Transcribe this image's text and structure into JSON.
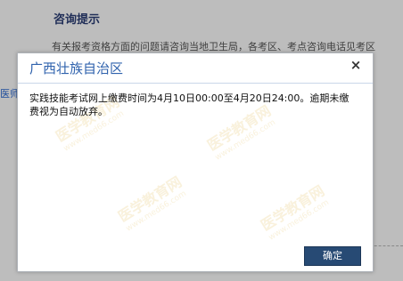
{
  "background": {
    "section_title": "咨询提示",
    "notice_text": "有关报考资格方面的问题请咨询当地卫生局，各考区、考点咨询电话见考区",
    "edge_link": "医师"
  },
  "dialog": {
    "title": "广西壮族自治区",
    "close_symbol": "×",
    "message": "实践技能考试网上缴费时间为4月10日00:00至4月20日24:00。逾期未缴费视为自动放弃。",
    "confirm_label": "确定",
    "watermark_text": "医学教育网",
    "watermark_url": "www.med66.com"
  },
  "colors": {
    "dialog_title": "#2f62ad",
    "confirm_button": "#274a74",
    "overlay": "#bdbdbd"
  }
}
